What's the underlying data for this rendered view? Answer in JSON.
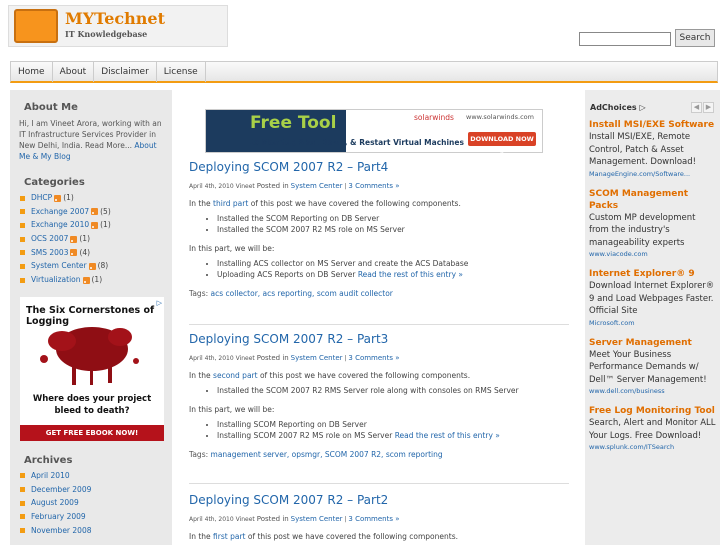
{
  "header": {
    "logo_prefix": "MY",
    "logo_suffix": "Technet",
    "tagline": "IT Knowledgebase",
    "search_value": "",
    "search_button": "Search"
  },
  "nav": [
    "Home",
    "About",
    "Disclaimer",
    "License"
  ],
  "sidebar": {
    "about_heading": "About Me",
    "about_text": "Hi, I am Vineet Arora, working with an IT Infrastructure Services Provider in New Delhi, India. Read More... ",
    "about_link": "About Me & My Blog",
    "categories_heading": "Categories",
    "categories": [
      {
        "name": "DHCP",
        "count": "(1)"
      },
      {
        "name": "Exchange 2007",
        "count": "(5)"
      },
      {
        "name": "Exchange 2010",
        "count": "(1)"
      },
      {
        "name": "OCS 2007",
        "count": "(1)"
      },
      {
        "name": "SMS 2003",
        "count": "(4)"
      },
      {
        "name": "System Center",
        "count": "(8)"
      },
      {
        "name": "Virtualization",
        "count": "(1)"
      }
    ],
    "ad": {
      "headline": "The Six Cornerstones of Logging",
      "question_1": "Where does your project",
      "question_2": "bleed to death?",
      "cta": "GET FREE EBOOK NOW!"
    },
    "archives_heading": "Archives",
    "archives": [
      "April 2010",
      "December 2009",
      "August 2009",
      "February 2009",
      "November 2008"
    ]
  },
  "banner": {
    "title": "Free Tool",
    "subtitle": "to Monitor, Shut Down, & Restart Virtual Machines",
    "brand": "solarwinds",
    "url": "www.solarwinds.com",
    "button": "DOWNLOAD NOW »"
  },
  "posts": [
    {
      "title": "Deploying SCOM 2007 R2 – Part4",
      "date": "April 4th, 2010",
      "author": "Vineet",
      "posted_in": "Posted in",
      "category": "System Center",
      "comments": "3 Comments »",
      "intro_pre": "In the ",
      "intro_link": "third part",
      "intro_post": " of this post we have covered the following components.",
      "covered": [
        "Installed the SCOM Reporting on DB Server",
        "Installed the SCOM 2007 R2 MS role on MS Server"
      ],
      "will_be": "In this part, we will be:",
      "todo": [
        "Installing ACS collector on MS Server and create the ACS Database",
        "Uploading ACS Reports on DB Server"
      ],
      "read_more": "Read the rest of this entry »",
      "tags_label": "Tags:",
      "tags": "acs collector, acs reporting, scom audit collector"
    },
    {
      "title": "Deploying SCOM 2007 R2 – Part3",
      "date": "April 4th, 2010",
      "author": "Vineet",
      "posted_in": "Posted in",
      "category": "System Center",
      "comments": "3 Comments »",
      "intro_pre": "In the ",
      "intro_link": "second part",
      "intro_post": " of this post we have covered the following components.",
      "covered": [
        "Installed the SCOM 2007 R2 RMS Server role along with consoles on RMS Server"
      ],
      "will_be": "In this part, we will be:",
      "todo": [
        "Installing SCOM Reporting on DB Server",
        "Installing SCOM 2007 R2 MS role on MS Server"
      ],
      "read_more": "Read the rest of this entry »",
      "tags_label": "Tags:",
      "tags": "management server, opsmgr, SCOM 2007 R2, scom reporting"
    },
    {
      "title": "Deploying SCOM 2007 R2 – Part2",
      "date": "April 4th, 2010",
      "author": "Vineet",
      "posted_in": "Posted in",
      "category": "System Center",
      "comments": "3 Comments »",
      "intro_pre": "In the ",
      "intro_link": "first part",
      "intro_post": " of this post we have covered the following components."
    }
  ],
  "right_ads": {
    "adchoices": "AdChoices",
    "items": [
      {
        "title": "Install MSI/EXE Software",
        "body": "Install MSI/EXE, Remote Control, Patch & Asset Management. Download!",
        "url": "ManageEngine.com/Software..."
      },
      {
        "title": "SCOM Management Packs",
        "body": "Custom MP development from the industry's manageability experts",
        "url": "www.viacode.com"
      },
      {
        "title": "Internet Explorer® 9",
        "body": "Download Internet Explorer® 9 and Load Webpages Faster. Official Site",
        "url": "Microsoft.com"
      },
      {
        "title": "Server Management",
        "body": "Meet Your Business Performance Demands w/ Dell™ Server Management!",
        "url": "www.dell.com/business"
      },
      {
        "title": "Free Log Monitoring Tool",
        "body": "Search, Alert and Monitor ALL Your Logs. Free Download!",
        "url": "www.splunk.com/ITSearch"
      }
    ]
  }
}
